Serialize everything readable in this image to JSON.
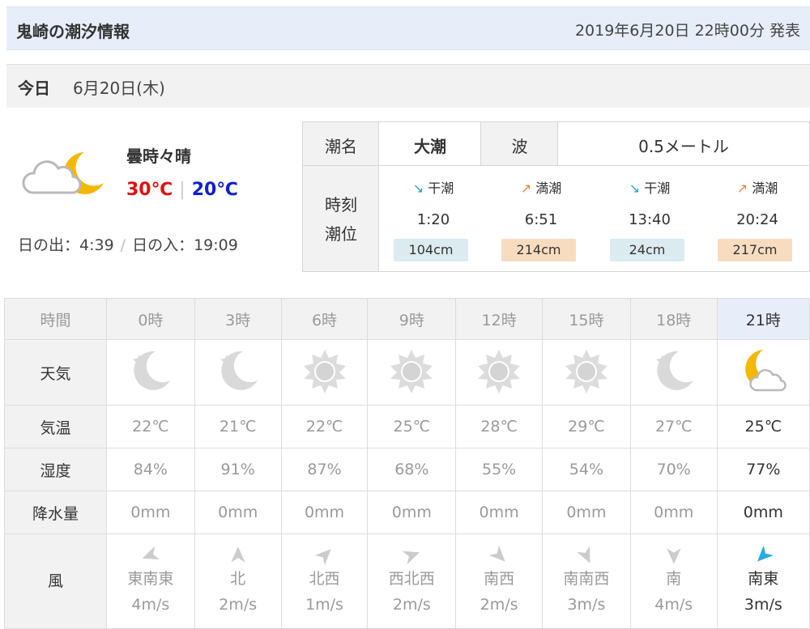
{
  "title": "鬼崎の潮汐情報",
  "published": "2019年6月20日 22時00分 発表",
  "day": {
    "label": "今日",
    "date": "6月20日(木)"
  },
  "today": {
    "weather": "曇時々晴",
    "high": "30℃",
    "low": "20℃",
    "sunrise": "日の出：4:39",
    "sunset": "日の入：19:09",
    "icon": "cloud-moon-icon"
  },
  "tide": {
    "name_label": "潮名",
    "name_value": "大潮",
    "wave_label": "波",
    "wave_value": "0.5メートル",
    "time_label": "時刻",
    "level_label": "潮位",
    "entries": [
      {
        "type": "干潮",
        "time": "1:20",
        "level": "104cm",
        "kind": "low"
      },
      {
        "type": "満潮",
        "time": "6:51",
        "level": "214cm",
        "kind": "high"
      },
      {
        "type": "干潮",
        "time": "13:40",
        "level": "24cm",
        "kind": "low"
      },
      {
        "type": "満潮",
        "time": "20:24",
        "level": "217cm",
        "kind": "high"
      }
    ]
  },
  "hourly": {
    "row_labels": {
      "time": "時間",
      "weather": "天気",
      "temp": "気温",
      "humidity": "湿度",
      "precip": "降水量",
      "wind": "風"
    },
    "columns": [
      {
        "time": "0時",
        "icon": "moon-icon",
        "temp": "22℃",
        "humidity": "84%",
        "precip": "0mm",
        "dir": "東南東",
        "speed": "4m/s",
        "rot": 200
      },
      {
        "time": "3時",
        "icon": "moon-icon",
        "temp": "21℃",
        "humidity": "91%",
        "precip": "0mm",
        "dir": "北",
        "speed": "2m/s",
        "rot": 90
      },
      {
        "time": "6時",
        "icon": "sun-icon",
        "temp": "22℃",
        "humidity": "87%",
        "precip": "0mm",
        "dir": "北西",
        "speed": "1m/s",
        "rot": 45
      },
      {
        "time": "9時",
        "icon": "sun-icon",
        "temp": "25℃",
        "humidity": "68%",
        "precip": "0mm",
        "dir": "西北西",
        "speed": "2m/s",
        "rot": 20
      },
      {
        "time": "12時",
        "icon": "sun-icon",
        "temp": "28℃",
        "humidity": "55%",
        "precip": "0mm",
        "dir": "南西",
        "speed": "2m/s",
        "rot": -45
      },
      {
        "time": "15時",
        "icon": "sun-icon",
        "temp": "29℃",
        "humidity": "54%",
        "precip": "0mm",
        "dir": "南南西",
        "speed": "3m/s",
        "rot": -65
      },
      {
        "time": "18時",
        "icon": "moon-icon",
        "temp": "27℃",
        "humidity": "70%",
        "precip": "0mm",
        "dir": "南",
        "speed": "4m/s",
        "rot": -90
      },
      {
        "time": "21時",
        "icon": "cloud-moon-icon",
        "temp": "25℃",
        "humidity": "77%",
        "precip": "0mm",
        "dir": "南東",
        "speed": "3m/s",
        "rot": -135,
        "current": true
      }
    ]
  }
}
